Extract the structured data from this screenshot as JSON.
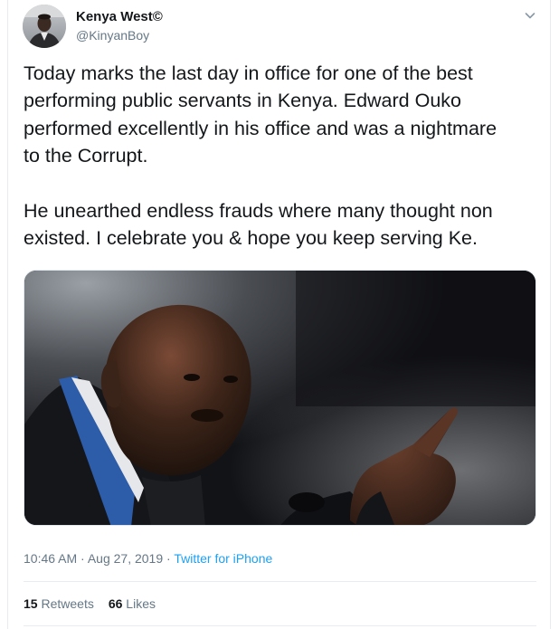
{
  "author": {
    "name": "Kenya West©",
    "handle": "@KinyanBoy"
  },
  "tweet": {
    "paragraphs": [
      "Today marks the last day in office for one of the best\nperforming public servants in Kenya. Edward Ouko\nperformed excellently in his office and was a nightmare\nto the Corrupt.",
      "He unearthed endless frauds where many thought non\nexisted. I celebrate you & hope you keep serving Ke."
    ]
  },
  "meta": {
    "timestamp": "10:46 AM · Aug 27, 2019",
    "separator": " · ",
    "source": "Twitter for iPhone"
  },
  "stats": {
    "retweets_count": "15",
    "retweets_label": "Retweets",
    "likes_count": "66",
    "likes_label": "Likes"
  },
  "icons": {
    "menu": "chevron-down-icon"
  },
  "colors": {
    "accent": "#1da1f2",
    "text_primary": "#14171a",
    "text_secondary": "#657786",
    "border": "#e6ecf0"
  }
}
